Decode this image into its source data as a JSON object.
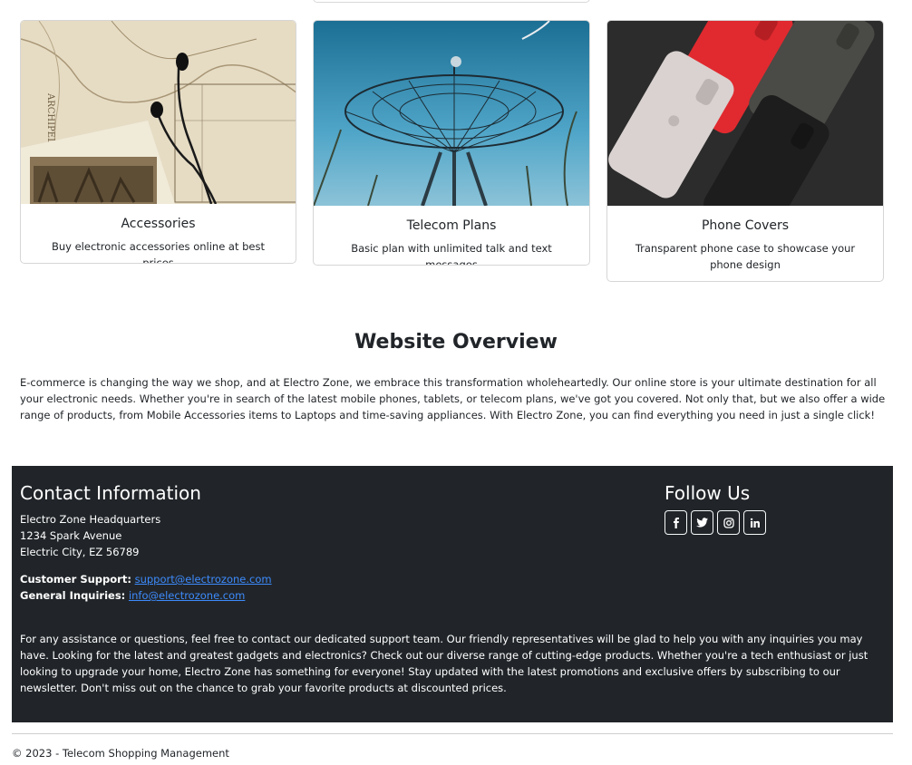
{
  "cards": [
    {
      "title": "Accessories",
      "text": "Buy electronic accessories online at best prices",
      "image": "map-earphones-photo"
    },
    {
      "title": "Telecom Plans",
      "text": "Basic plan with unlimited talk and text messages",
      "image": "satellite-dish-photo"
    },
    {
      "title": "Phone Covers",
      "text": "Transparent phone case to showcase your phone design",
      "image": "phone-cases-photo"
    }
  ],
  "overview": {
    "title": "Website Overview",
    "text": "E-commerce is changing the way we shop, and at Electro Zone, we embrace this transformation wholeheartedly. Our online store is your ultimate destination for all your electronic needs. Whether you're in search of the latest mobile phones, tablets, or telecom plans, we've got you covered. Not only that, but we also offer a wide range of products, from Mobile Accessories items to Laptops and time-saving appliances. With Electro Zone, you can find everything you need in just a single click!"
  },
  "footer": {
    "contact_title": "Contact Information",
    "address": [
      "Electro Zone Headquarters",
      "1234 Spark Avenue",
      "Electric City, EZ 56789"
    ],
    "support_label": "Customer Support:",
    "support_email": "support@electrozone.com",
    "inquiries_label": "General Inquiries:",
    "inquiries_email": "info@electrozone.com",
    "follow_title": "Follow Us",
    "social": [
      "facebook-icon",
      "twitter-icon",
      "instagram-icon",
      "linkedin-icon"
    ],
    "paragraph": "For any assistance or questions, feel free to contact our dedicated support team. Our friendly representatives will be glad to help you with any inquiries you may have. Looking for the latest and greatest gadgets and electronics? Check out our diverse range of cutting-edge products. Whether you're a tech enthusiast or just looking to upgrade your home, Electro Zone has something for everyone! Stay updated with the latest promotions and exclusive offers by subscribing to our newsletter. Don't miss out on the chance to grab your favorite products at discounted prices."
  },
  "copyright": "© 2023 - Telecom Shopping Management",
  "colors": {
    "footer_bg": "#212529",
    "link": "#3d8bfd",
    "text": "#212529"
  }
}
